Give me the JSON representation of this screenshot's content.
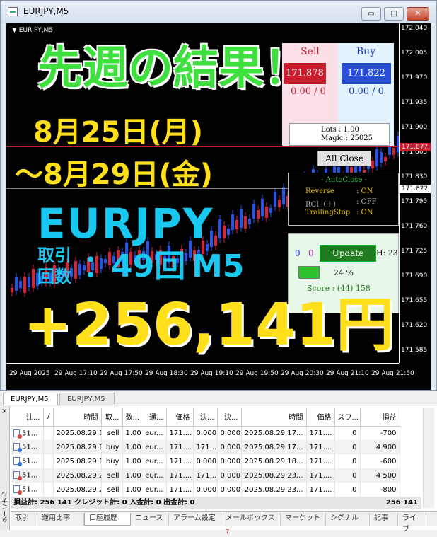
{
  "window": {
    "title": "EURJPY,M5",
    "min_label": "▭",
    "max_label": "□",
    "close_label": "✕"
  },
  "chart": {
    "symbol_label": "▼ EURJPY,M5",
    "y_ticks": [
      "172.040",
      "172.005",
      "171.970",
      "171.935",
      "171.900",
      "171.865",
      "171.830",
      "171.795",
      "171.760",
      "171.725",
      "171.690",
      "171.655",
      "171.620",
      "171.585"
    ],
    "x_ticks": [
      "29 Aug 2025",
      "29 Aug 17:10",
      "29 Aug 17:50",
      "29 Aug 18:30",
      "29 Aug 19:10",
      "29 Aug 19:50",
      "29 Aug 20:30",
      "29 Aug 21:10",
      "29 Aug 21:50"
    ],
    "ask_tag": "171.877",
    "bid_tag": "171.822"
  },
  "overlay": {
    "headline": "先週の結果！",
    "date1": "8月25日(月)",
    "date2": "～8月29日(金)",
    "pair": "EURJPY",
    "trades_label_1": "取引",
    "trades_label_2": "回数",
    "trades_colon": "：",
    "trades_value": "49回",
    "timeframe": "M5",
    "profit": "+256,141円"
  },
  "panel": {
    "sell_label": "Sell",
    "buy_label": "Buy",
    "sell_price": "171.878",
    "buy_price": "171.822",
    "sell_count": "0.00 / 0",
    "buy_count": "0.00 / 0",
    "lots": "Lots   : 1.00",
    "magic": "Magic : 25025",
    "all_close": "All Close",
    "autoclose_title": "- AutoClose -",
    "reverse_k": "Reverse",
    "reverse_v": ": ON",
    "rci_k": "RCI（＋）",
    "rci_v": ": OFF",
    "trailing_k": "TrailingStop",
    "trailing_v": ": ON",
    "left_zero": "0",
    "right_zero": "0",
    "update": "Update",
    "h_label": "H: 23",
    "percent": "24 %",
    "score": "Score : (44) 158"
  },
  "chart_tabs": [
    "EURJPY,M5",
    "EURJPY,M5"
  ],
  "terminal": {
    "side_close": "×",
    "side_label": "ターミナル",
    "columns": [
      "注...",
      "/",
      "時間",
      "取...",
      "数...",
      "通...",
      "価格",
      "決...",
      "決...",
      "時間",
      "価格",
      "スワ...",
      "損益"
    ],
    "rows": [
      {
        "id": "51...",
        "time": "2025.08.29 16...",
        "type": "sell",
        "vol": "1.00",
        "sym": "eur...",
        "price": "171....",
        "sl": "0.000",
        "tp": "0.000",
        "ctime": "2025.08.29 17...",
        "cprice": "171....",
        "swap": "0",
        "profit": "-700",
        "dot": "#d9443b",
        "hl": false
      },
      {
        "id": "51...",
        "time": "2025.08.29 17...",
        "type": "buy",
        "vol": "1.00",
        "sym": "eur...",
        "price": "171....",
        "sl": "171....",
        "tp": "0.000",
        "ctime": "2025.08.29 17...",
        "cprice": "171....",
        "swap": "0",
        "profit": "4 900",
        "dot": "#2c72d6",
        "hl": true
      },
      {
        "id": "51...",
        "time": "2025.08.29 18...",
        "type": "buy",
        "vol": "1.00",
        "sym": "eur...",
        "price": "171....",
        "sl": "0.000",
        "tp": "0.000",
        "ctime": "2025.08.29 18...",
        "cprice": "171....",
        "swap": "0",
        "profit": "-600",
        "dot": "#2c72d6",
        "hl": false
      },
      {
        "id": "51...",
        "time": "2025.08.29 21...",
        "type": "sell",
        "vol": "1.00",
        "sym": "eur...",
        "price": "171....",
        "sl": "171....",
        "tp": "0.000",
        "ctime": "2025.08.29 23...",
        "cprice": "171....",
        "swap": "0",
        "profit": "4 500",
        "dot": "#d9443b",
        "hl": true
      },
      {
        "id": "51...",
        "time": "2025.08.29 22...",
        "type": "sell",
        "vol": "1.00",
        "sym": "eur...",
        "price": "171....",
        "sl": "0.000",
        "tp": "0.000",
        "ctime": "2025.08.29 23...",
        "cprice": "171....",
        "swap": "0",
        "profit": "-800",
        "dot": "#d9443b",
        "hl": false
      }
    ],
    "summary": "損益計: 256 141  クレジット計: 0  入金計: 0  出金計: 0",
    "summary_total": "256 141",
    "tabs": [
      "取引",
      "運用比率",
      "口座履歴",
      "ニュース",
      "アラーム設定",
      "メールボックス",
      "マーケット",
      "シグナル",
      "記事",
      "ライブ"
    ],
    "mail_badge": "7",
    "active_tab": 2
  },
  "colors": {
    "bull": "#2255ee",
    "bear": "#e0203a",
    "headline_green": "#3ee03e",
    "yellow": "#ffe01a",
    "cyan": "#18c8f0"
  }
}
